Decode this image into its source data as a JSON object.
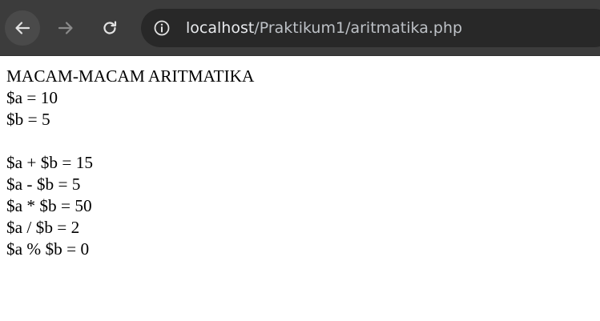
{
  "browser": {
    "url_host": "localhost",
    "url_path": "/Praktikum1/aritmatika.php",
    "icons": {
      "back": "arrow-left-icon",
      "forward": "arrow-right-icon",
      "reload": "reload-icon",
      "site_info": "info-circle-icon"
    }
  },
  "page": {
    "title": "MACAM-MACAM ARITMATIKA",
    "var_a": "$a = 10",
    "var_b": "$b = 5",
    "sum": "$a + $b = 15",
    "difference": "$a - $b = 5",
    "product": "$a * $b = 50",
    "quotient": "$a / $b = 2",
    "modulo": "$a % $b = 0"
  },
  "colors": {
    "toolbar_bg": "#3c3c3c",
    "omnibox_bg": "#282828",
    "url_text": "#e8eaed"
  }
}
